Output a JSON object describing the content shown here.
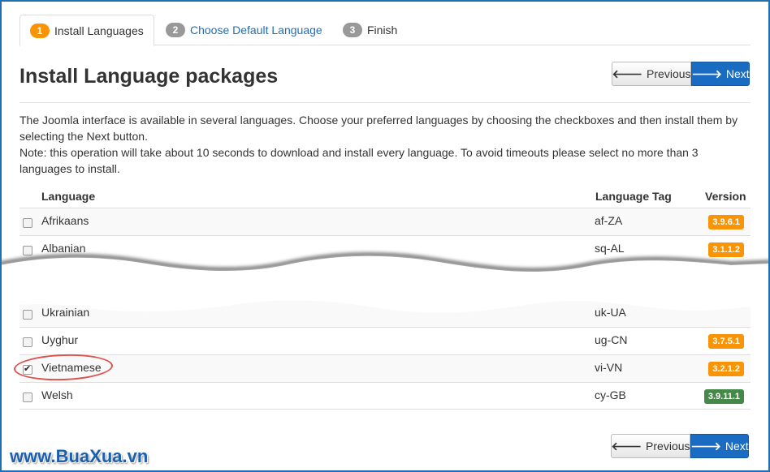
{
  "tabs": [
    {
      "num": "1",
      "label": "Install Languages"
    },
    {
      "num": "2",
      "label": "Choose Default Language"
    },
    {
      "num": "3",
      "label": "Finish"
    }
  ],
  "title": "Install Language packages",
  "nav": {
    "previous": "Previous",
    "next": "Next"
  },
  "description": {
    "line1": "The Joomla interface is available in several languages. Choose your preferred languages by choosing the checkboxes and then install them by",
    "line2": "selecting the Next button.",
    "line3": "Note: this operation will take about 10 seconds to download and install every language. To avoid timeouts please select no more than 3",
    "line4": "languages to install."
  },
  "table": {
    "headers": {
      "language": "Language",
      "tag": "Language Tag",
      "version": "Version"
    },
    "rows": [
      {
        "name": "Afrikaans",
        "tag": "af-ZA",
        "version": "3.9.6.1",
        "checked": false
      },
      {
        "name": "Albanian",
        "tag": "sq-AL",
        "version": "3.1.1.2",
        "checked": false
      },
      {
        "name": "Ukrainian",
        "tag": "uk-UA",
        "version": "",
        "checked": false
      },
      {
        "name": "Uyghur",
        "tag": "ug-CN",
        "version": "3.7.5.1",
        "checked": false
      },
      {
        "name": "Vietnamese",
        "tag": "vi-VN",
        "version": "3.2.1.2",
        "checked": true
      },
      {
        "name": "Welsh",
        "tag": "cy-GB",
        "version": "3.9.11.1",
        "checked": false
      }
    ]
  },
  "watermark": "www.BuaXua.vn",
  "colors": {
    "accent": "#1a6bc2",
    "orange": "#f89406",
    "green": "#468847",
    "highlight": "#d9534f"
  }
}
